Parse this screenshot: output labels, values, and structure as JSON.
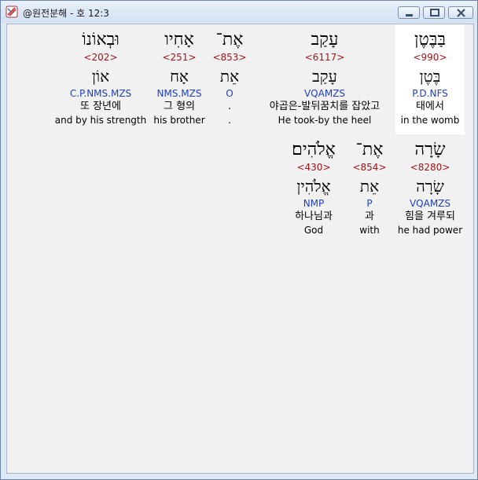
{
  "window": {
    "title": "@원전분해 - 호 12:3"
  },
  "rows": [
    [
      {
        "heb": "בַּבֶּטֶן",
        "strong": "<990>",
        "lemma": "בֶּטֶן",
        "parse": "P.D.NFS",
        "kor": "태에서",
        "eng": "in the womb",
        "selected": true
      },
      {
        "heb": "עָקַב",
        "strong": "<6117>",
        "lemma": "עָקַב",
        "parse": "VQAMZS",
        "kor": "야곱은-발뒤꿈치를 잡았고",
        "eng": "He took-by the heel",
        "selected": false
      },
      {
        "heb": "אֶת־",
        "strong": "<853>",
        "lemma": "אֵת",
        "parse": "O",
        "kor": ".",
        "eng": ".",
        "selected": false
      },
      {
        "heb": "אָחִיו",
        "strong": "<251>",
        "lemma": "אָח",
        "parse": "NMS.MZS",
        "kor": "그 형의",
        "eng": "his brother",
        "selected": false
      },
      {
        "heb": "וּבְאוֹנוֹ",
        "strong": "<202>",
        "lemma": "אוֹן",
        "parse": "C.P.NMS.MZS",
        "kor": "또 장년에",
        "eng": "and by his strength",
        "selected": false
      }
    ],
    [
      {
        "heb": "שָׂרָה",
        "strong": "<8280>",
        "lemma": "שָׂרָה",
        "parse": "VQAMZS",
        "kor": "힘을 겨루되",
        "eng": "he had power",
        "selected": false
      },
      {
        "heb": "אֶת־",
        "strong": "<854>",
        "lemma": "אֵת",
        "parse": "P",
        "kor": "과",
        "eng": "with",
        "selected": false
      },
      {
        "heb": "אֱלֹהִים׃",
        "strong": "<430>",
        "lemma": "אֱלֹהִין",
        "parse": "NMP",
        "kor": "하나님과",
        "eng": "God",
        "selected": false
      }
    ]
  ]
}
